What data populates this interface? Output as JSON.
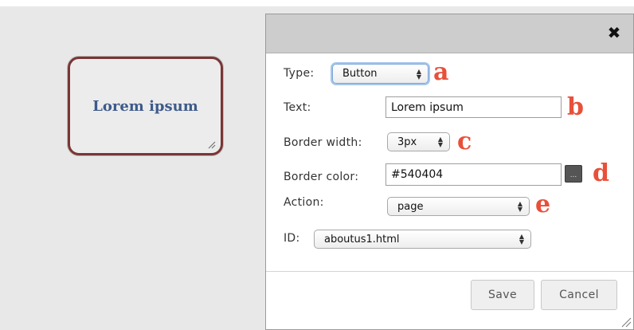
{
  "preview": {
    "button_label": "Lorem ipsum"
  },
  "dialog": {
    "close_icon": "close-icon",
    "type": {
      "label": "Type:",
      "value": "Button",
      "marker": "a"
    },
    "text": {
      "label": "Text:",
      "value": "Lorem ipsum",
      "marker": "b"
    },
    "border_width": {
      "label": "Border width:",
      "value": "3px",
      "marker": "c"
    },
    "border_color": {
      "label": "Border color:",
      "value": "#540404",
      "picker_label": "...",
      "marker": "d"
    },
    "action": {
      "label": "Action:",
      "value": "page",
      "marker": "e"
    },
    "id": {
      "label": "ID:",
      "value": "aboutus1.html"
    },
    "save_label": "Save",
    "cancel_label": "Cancel"
  },
  "colors": {
    "marker": "#e8503a",
    "preview_border": "#7a3535",
    "preview_text": "#3d5a8a"
  }
}
